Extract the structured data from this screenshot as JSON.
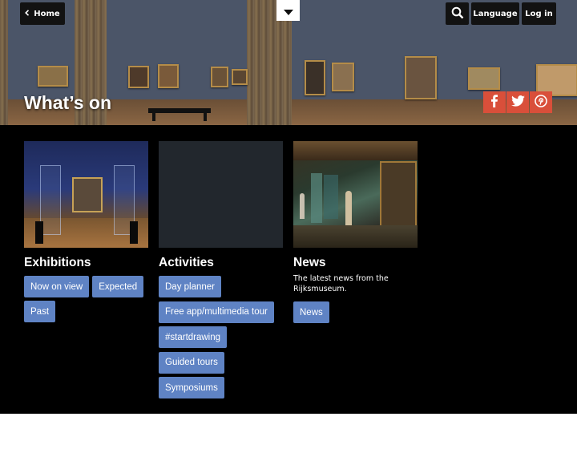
{
  "header": {
    "home_label": "Home",
    "language_label": "Language",
    "login_label": "Log in",
    "title": "What’s on"
  },
  "icons": {
    "home": "chevron-left-icon",
    "menu": "caret-down-icon",
    "search": "search-icon",
    "share": [
      "facebook-icon",
      "twitter-icon",
      "pinterest-icon"
    ]
  },
  "colors": {
    "background": "#000000",
    "button": "#5f83c4",
    "share": "#d94f3a",
    "header_button": "#121212"
  },
  "sections": [
    {
      "title": "Exhibitions",
      "buttons": [
        "Now on view",
        "Expected",
        "Past"
      ]
    },
    {
      "title": "Activities",
      "buttons": [
        "Day planner",
        "Free app/multimedia tour",
        "#startdrawing",
        "Guided tours",
        "Symposiums"
      ]
    },
    {
      "title": "News",
      "description": "The latest news from the Rijksmuseum.",
      "buttons": [
        "News"
      ]
    }
  ]
}
